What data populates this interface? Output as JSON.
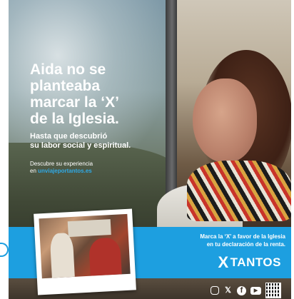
{
  "headline": {
    "lines": [
      "Aida no se",
      "planteaba",
      "marcar la ‘X’",
      "de la Iglesia."
    ]
  },
  "subline": {
    "lines": [
      "Hasta que descubrió",
      "su labor social y espiritual."
    ]
  },
  "discover": {
    "label": "Descubre su experiencia",
    "prefix": "en",
    "link": "unviajeportantos.es"
  },
  "band": {
    "lines": [
      "Marca la ‘X’ a favor de la Iglesia",
      "en tu declaración de la renta."
    ]
  },
  "brand": {
    "mark": "X",
    "name": "TANTOS"
  },
  "social": [
    "instagram-icon",
    "x-icon",
    "facebook-icon",
    "youtube-icon",
    "qr-code"
  ],
  "colors": {
    "band_blue": "#1d9fe0",
    "link_blue": "#2fa9e6",
    "text_white": "#ffffff"
  }
}
